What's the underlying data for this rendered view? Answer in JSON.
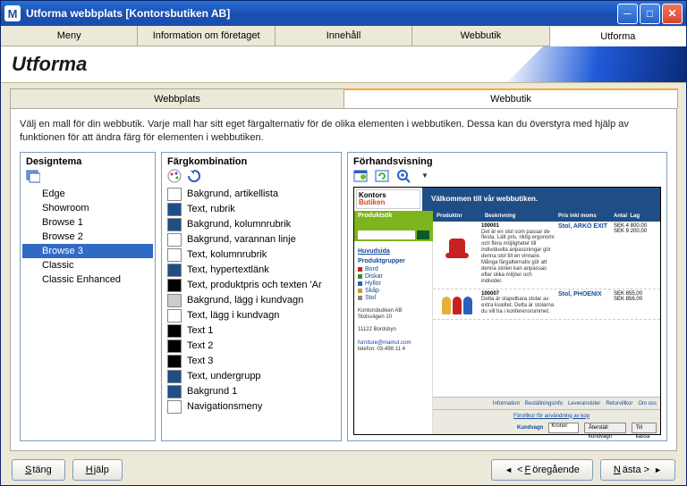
{
  "window": {
    "title": "Utforma webbplats [Kontorsbutiken AB]"
  },
  "topnav": [
    "Meny",
    "Information om företaget",
    "Innehåll",
    "Webbutik",
    "Utforma"
  ],
  "page_heading": "Utforma",
  "subtabs": {
    "a": "Webbplats",
    "b": "Webbutik"
  },
  "intro": "Välj en mall för din webbutik. Varje mall har sitt eget färgalternativ för de olika elementen i webbutiken. Dessa kan du överstyra med hjälp av funktionen för att ändra färg för elementen i webbutiken.",
  "panel_theme": {
    "title": "Designtema",
    "items": [
      "Edge",
      "Showroom",
      "Browse 1",
      "Browse 2",
      "Browse 3",
      "Classic",
      "Classic Enhanced"
    ],
    "selected": "Browse 3"
  },
  "panel_colors": {
    "title": "Färgkombination",
    "items": [
      {
        "label": "Bakgrund, artikellista",
        "hex": "#ffffff"
      },
      {
        "label": "Text, rubrik",
        "hex": "#1f4e86"
      },
      {
        "label": "Bakgrund, kolumnrubrik",
        "hex": "#1f4e86"
      },
      {
        "label": "Bakgrund, varannan linje",
        "hex": "#ffffff"
      },
      {
        "label": "Text, kolumnrubrik",
        "hex": "#ffffff"
      },
      {
        "label": "Text, hypertextlänk",
        "hex": "#1f4e86"
      },
      {
        "label": "Text, produktpris och texten 'Ar",
        "hex": "#000000"
      },
      {
        "label": "Bakgrund, lägg i kundvagn",
        "hex": "#cccccc"
      },
      {
        "label": "Text, lägg i kundvagn",
        "hex": "#ffffff"
      },
      {
        "label": "Text 1",
        "hex": "#000000"
      },
      {
        "label": "Text 2",
        "hex": "#000000"
      },
      {
        "label": "Text 3",
        "hex": "#000000"
      },
      {
        "label": "Text, undergrupp",
        "hex": "#1f4e86"
      },
      {
        "label": "Bakgrund 1",
        "hex": "#1f4e86"
      },
      {
        "label": "Navigationsmeny",
        "hex": "#ffffff"
      }
    ]
  },
  "panel_preview": {
    "title": "Förhandsvisning",
    "logo1": "Kontors",
    "logo2": "Butiken",
    "banner": "Välkommen till vår webbutiken.",
    "search_label": "Produktsök",
    "side_home": "Huvudsida",
    "side_groups": "Produktgrupper",
    "side_items": [
      {
        "label": "Bord",
        "hex": "#c62222"
      },
      {
        "label": "Diskar",
        "hex": "#3a8a3a"
      },
      {
        "label": "Hyllor",
        "hex": "#2a60c0"
      },
      {
        "label": "Skåp",
        "hex": "#c99b2a"
      },
      {
        "label": "Stol",
        "hex": "#888888"
      }
    ],
    "addr1": "Kontorsbutiken AB",
    "addr2": "Stolsvägen 10",
    "addr3": "11122 Bordsbyn",
    "email": "furniture@mamut.com",
    "tel": "telefon: 03-498 11 4",
    "cols": [
      "Produktnr",
      "Beskrivning",
      "Pris inkl moms",
      "Antal",
      "Lag"
    ],
    "rows": [
      {
        "id": "100001",
        "name": "Stol, ARKO EXIT",
        "desc": "Det är en stol som passar de flesta. Lätt pris, riktig ergonomi och flera möjligheter till individuella anpassningar gör denna stol till en vinnare. Många färgalternativ gör att denna stolen kan anpassas efter olika miljöer och individer.",
        "p1": "SEK 4 800,00",
        "p2": "SEK 9 200,00"
      },
      {
        "id": "100007",
        "name": "Stol, PHOENIX",
        "desc": "Detta är stapelbara stolar av extra kvalitet. Delta är stolarna du vill ha i konferensrummet.",
        "p1": "SEK 855,00",
        "p2": "SEK 856,00"
      }
    ],
    "bottom_tabs": [
      "Information",
      "Beställningsinfo",
      "Leveranstider",
      "Returvillkor",
      "Om oss"
    ],
    "reg": "Förvillkor för användning av kop",
    "cart": "Kundvagn",
    "cart_sel": "Kronor",
    "cart_b1": "Återställ kundvagn",
    "cart_b2": "Till kassa"
  },
  "footer": {
    "close": "Stäng",
    "help": "Hjälp",
    "prev": "Föregående",
    "next": "Nästa"
  }
}
